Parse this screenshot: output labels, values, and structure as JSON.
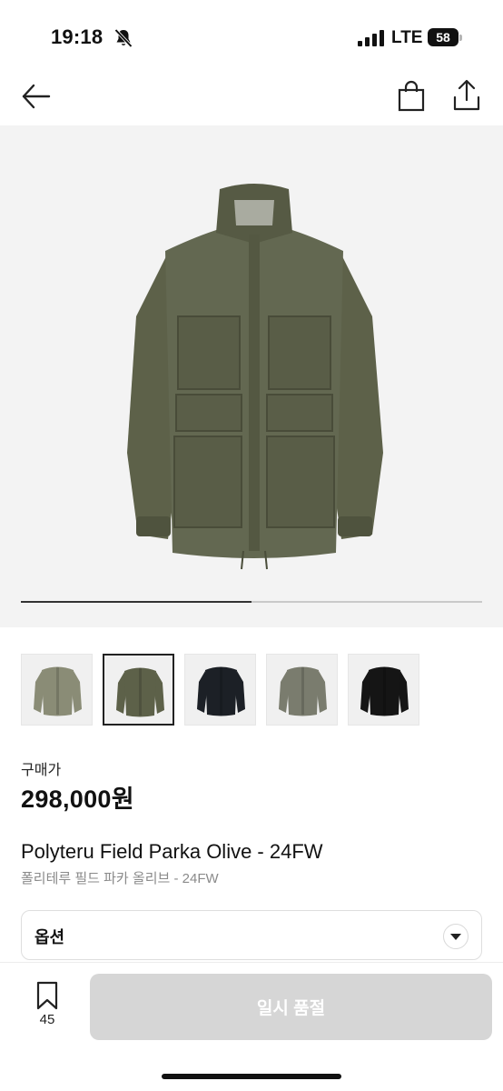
{
  "status_bar": {
    "time": "19:18",
    "network": "LTE",
    "battery": "58",
    "icons": [
      "bell-off-icon",
      "signal-icon",
      "battery-icon"
    ]
  },
  "nav": {
    "icons": [
      "back-arrow-icon",
      "shopping-bag-icon",
      "share-icon"
    ]
  },
  "gallery": {
    "image": "olive field parka",
    "progress_fraction": 0.5,
    "thumbnails": [
      {
        "name": "light-olive",
        "color": "#8a8c76",
        "selected": false
      },
      {
        "name": "olive",
        "color": "#5d6149",
        "selected": true
      },
      {
        "name": "navy",
        "color": "#1c2026",
        "selected": false
      },
      {
        "name": "grey-olive",
        "color": "#7a7c6e",
        "selected": false
      },
      {
        "name": "black",
        "color": "#151515",
        "selected": false
      }
    ]
  },
  "price": {
    "label": "구매가",
    "value": "298,000원"
  },
  "product": {
    "title": "Polyteru Field Parka Olive - 24FW",
    "subtitle": "폴리테루 필드 파카 올리브 - 24FW"
  },
  "option": {
    "label": "옵션"
  },
  "bottom": {
    "bookmark_count": "45",
    "button_label": "일시 품절"
  },
  "colors": {
    "accent": "#111111",
    "disabled_button": "#d6d6d6",
    "jacket": "#5f634c"
  }
}
